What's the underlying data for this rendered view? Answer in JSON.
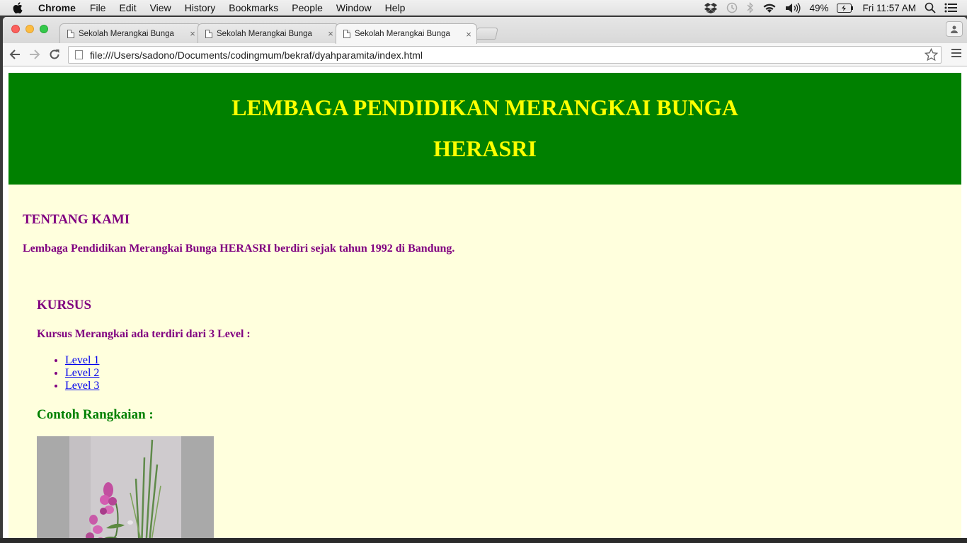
{
  "menubar": {
    "app": "Chrome",
    "items": [
      "File",
      "Edit",
      "View",
      "History",
      "Bookmarks",
      "People",
      "Window",
      "Help"
    ],
    "battery": "49%",
    "clock": "Fri 11:57 AM"
  },
  "browser": {
    "tabs": [
      {
        "title": "Sekolah Merangkai Bunga",
        "close": "×"
      },
      {
        "title": "Sekolah Merangkai Bunga",
        "close": "×"
      },
      {
        "title": "Sekolah Merangkai Bunga",
        "close": "×"
      }
    ],
    "url": "file:///Users/sadono/Documents/codingmum/bekraf/dyahparamita/index.html"
  },
  "page": {
    "header": {
      "line1": "LEMBAGA PENDIDIKAN MERANGKAI BUNGA",
      "line2": "HERASRI"
    },
    "about": {
      "title": "TENTANG KAMI",
      "text": "Lembaga Pendidikan Merangkai Bunga HERASRI berdiri sejak tahun 1992 di Bandung."
    },
    "kursus": {
      "title": "KURSUS",
      "text": "Kursus Merangkai ada terdiri dari 3 Level :",
      "levels": [
        "Level 1",
        "Level 2",
        "Level 3"
      ]
    },
    "contoh": {
      "title": "Contoh Rangkaian :"
    }
  },
  "colors": {
    "header_bg": "#008000",
    "header_text": "#ffff00",
    "content_bg": "#ffffdd",
    "content_text": "#800080",
    "link": "#0000ee",
    "contoh_title": "#008000"
  },
  "icons": [
    "apple-icon",
    "dropbox-icon",
    "time-machine-icon",
    "bluetooth-icon",
    "wifi-icon",
    "volume-icon",
    "battery-icon",
    "spotlight-icon",
    "notification-center-icon",
    "back-icon",
    "forward-icon",
    "reload-icon",
    "page-icon",
    "bookmark-star-icon",
    "chrome-menu-icon",
    "profile-icon"
  ]
}
